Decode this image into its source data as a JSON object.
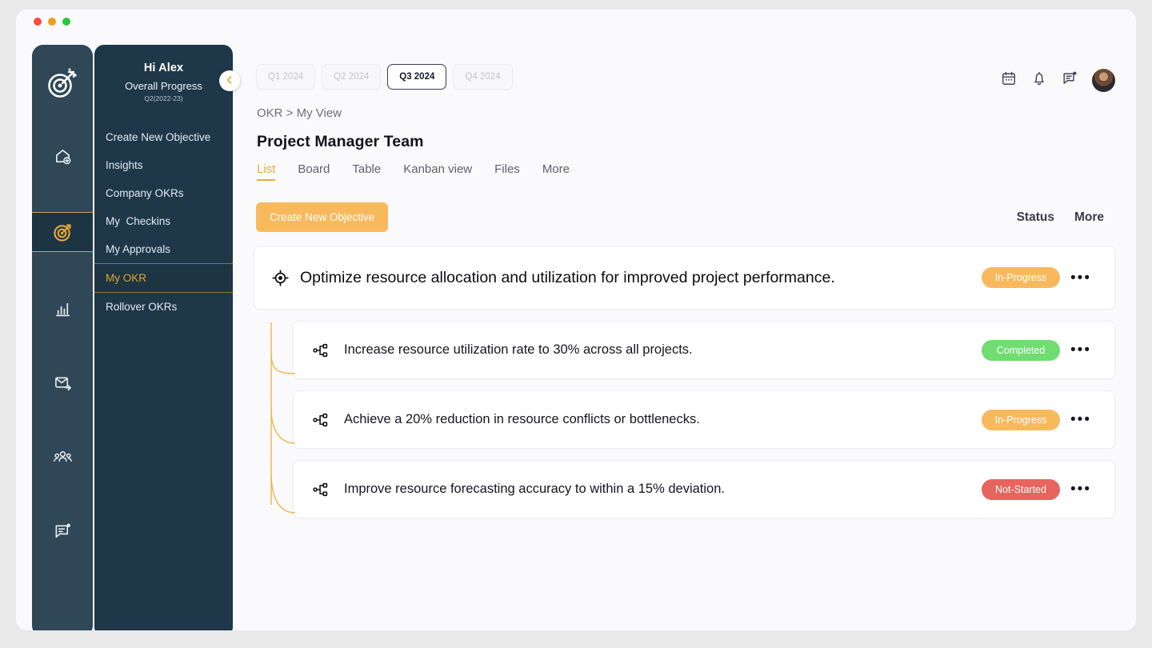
{
  "window": {
    "traffic_lights": [
      "close",
      "minimize",
      "maximize"
    ]
  },
  "rail": {
    "logo_name": "target-arrow-logo",
    "items": [
      {
        "icon": "home-add-icon",
        "name": "rail-item-home",
        "active": false
      },
      {
        "icon": "target-icon",
        "name": "rail-item-okr",
        "active": true
      },
      {
        "icon": "bar-chart-icon",
        "name": "rail-item-analytics",
        "active": false
      },
      {
        "icon": "mail-send-icon",
        "name": "rail-item-mail",
        "active": false
      },
      {
        "icon": "people-icon",
        "name": "rail-item-team",
        "active": false
      },
      {
        "icon": "feedback-icon",
        "name": "rail-item-feedback",
        "active": false
      }
    ]
  },
  "sidebar": {
    "greeting": "Hi Alex",
    "progress_label": "Overall Progress",
    "quarter_label": "Q2(2022-23)",
    "collapse_icon": "chevron-left-icon",
    "items": [
      {
        "label": "Create New Objective",
        "active": false
      },
      {
        "label": "Insights",
        "active": false
      },
      {
        "label": "Company OKRs",
        "active": false
      },
      {
        "label": "My  Checkins",
        "active": false
      },
      {
        "label": "My Approvals",
        "active": false
      },
      {
        "label": "My OKR",
        "active": true
      },
      {
        "label": "Rollover OKRs",
        "active": false
      }
    ]
  },
  "header": {
    "quarters": [
      {
        "label": "Q1 2024",
        "active": false
      },
      {
        "label": "Q2 2024",
        "active": false
      },
      {
        "label": "Q3 2024",
        "active": true
      },
      {
        "label": "Q4 2024",
        "active": false
      }
    ],
    "icons": [
      {
        "name": "calendar-icon"
      },
      {
        "name": "bell-icon"
      },
      {
        "name": "message-icon"
      }
    ],
    "avatar_name": "user-avatar"
  },
  "breadcrumb": "OKR > My View",
  "page_title": "Project Manager Team",
  "view_tabs": [
    {
      "label": "List",
      "active": true
    },
    {
      "label": "Board",
      "active": false
    },
    {
      "label": "Table",
      "active": false
    },
    {
      "label": "Kanban view",
      "active": false
    },
    {
      "label": "Files",
      "active": false
    },
    {
      "label": "More",
      "active": false
    }
  ],
  "toolbar": {
    "create_label": "Create New Objective",
    "status_header": "Status",
    "more_header": "More"
  },
  "objective": {
    "icon": "crosshair-target-icon",
    "text": "Optimize resource allocation and utilization for improved project performance.",
    "status": "In-Progress",
    "status_color": "#f8b95d",
    "more_dots": "•••"
  },
  "key_results": [
    {
      "icon": "hierarchy-icon",
      "text": "Increase resource utilization rate to 30% across all projects.",
      "status": "Completed",
      "status_color": "#6fdd72",
      "more_dots": "•••"
    },
    {
      "icon": "hierarchy-icon",
      "text": "Achieve a 20% reduction in resource conflicts or bottlenecks.",
      "status": "In-Progress",
      "status_color": "#f8b95d",
      "more_dots": "•••"
    },
    {
      "icon": "hierarchy-icon",
      "text": "Improve resource forecasting accuracy to within a 15% deviation.",
      "status": "Not-Started",
      "status_color": "#e8645e",
      "more_dots": "•••"
    }
  ],
  "colors": {
    "rail_bg": "#2f4757",
    "panel_bg": "#1e3849",
    "accent_orange": "#e8a93a",
    "connector": "#f2b44b",
    "page_bg": "#fafafc"
  }
}
